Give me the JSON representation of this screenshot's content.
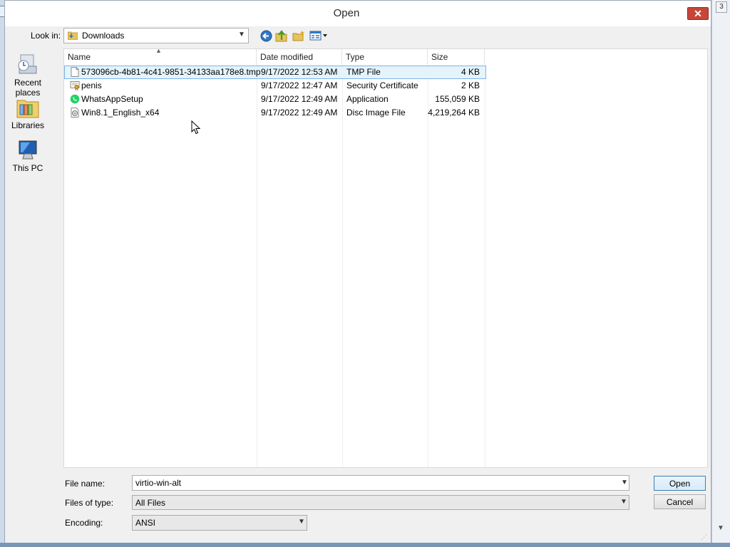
{
  "dialog": {
    "title": "Open",
    "close_label": "✕",
    "background_window_button": "3"
  },
  "toolbar": {
    "look_in_label": "Look in:",
    "look_in_value": "Downloads",
    "back_icon": "back-arrow-icon",
    "up_icon": "up-folder-icon",
    "new_folder_icon": "new-folder-icon",
    "views_icon": "views-menu-icon"
  },
  "places": [
    {
      "label": "Recent places",
      "icon": "recent-places-icon"
    },
    {
      "label": "Libraries",
      "icon": "libraries-icon"
    },
    {
      "label": "This PC",
      "icon": "this-pc-icon"
    }
  ],
  "columns": {
    "name": "Name",
    "date": "Date modified",
    "type": "Type",
    "size": "Size"
  },
  "files": [
    {
      "name": "573096cb-4b81-4c41-9851-34133aa178e8.tmp",
      "date": "9/17/2022 12:53 AM",
      "type": "TMP File",
      "size": "4 KB",
      "icon": "blank-file-icon",
      "selected": true
    },
    {
      "name": "penis",
      "date": "9/17/2022 12:47 AM",
      "type": "Security Certificate",
      "size": "2 KB",
      "icon": "certificate-icon",
      "selected": false
    },
    {
      "name": "WhatsAppSetup",
      "date": "9/17/2022 12:49 AM",
      "type": "Application",
      "size": "155,059 KB",
      "icon": "whatsapp-icon",
      "selected": false
    },
    {
      "name": "Win8.1_English_x64",
      "date": "9/17/2022 12:49 AM",
      "type": "Disc Image File",
      "size": "4,219,264 KB",
      "icon": "disc-image-icon",
      "selected": false
    }
  ],
  "form": {
    "file_name_label": "File name:",
    "file_name_value": "virtio-win-alt",
    "file_type_label": "Files of type:",
    "file_type_value": "All Files",
    "encoding_label": "Encoding:",
    "encoding_value": "ANSI",
    "open_label": "Open",
    "cancel_label": "Cancel"
  },
  "colors": {
    "selection_bg": "#e5f3fb",
    "selection_border": "#7eb4ea",
    "close_button": "#c7463a"
  }
}
